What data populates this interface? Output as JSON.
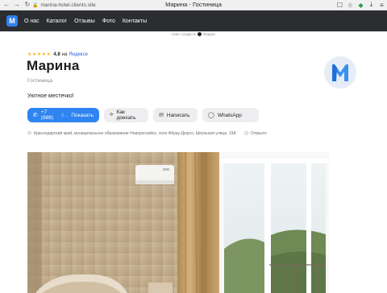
{
  "browser": {
    "url": "marina-hotel.clients.site",
    "tab_title": "Марина - Гостиница",
    "back_icon": "arrow-left-icon",
    "forward_icon": "arrow-right-icon",
    "reload_icon": "reload-icon"
  },
  "nav": {
    "logo_letter": "M",
    "items": [
      "О нас",
      "Каталог",
      "Отзывы",
      "Фото",
      "Контакты"
    ]
  },
  "made_with": {
    "prefix": "Сайт создан в",
    "brand": "Яндекс"
  },
  "rating": {
    "stars": "★★★★★",
    "value": "4.8",
    "on": "на",
    "source": "Яндексе"
  },
  "hotel": {
    "name": "Марина",
    "category": "Гостиница",
    "tagline": "Уютное местечко!"
  },
  "buttons": {
    "phone": "+7 (988)",
    "phone_hidden": "3...",
    "show": "Показать",
    "route": "Как доехать",
    "write": "Написать",
    "whatsapp": "WhatsApp"
  },
  "address": {
    "text": "Краснодарский край, муниципальное образование Новороссийск, село Абрау-Дюрсо, Школьная улица, 19А",
    "status": "Открыто"
  },
  "colors": {
    "accent": "#2e84f0",
    "nav_bg": "#2b2d31",
    "star": "#f5b91a"
  }
}
